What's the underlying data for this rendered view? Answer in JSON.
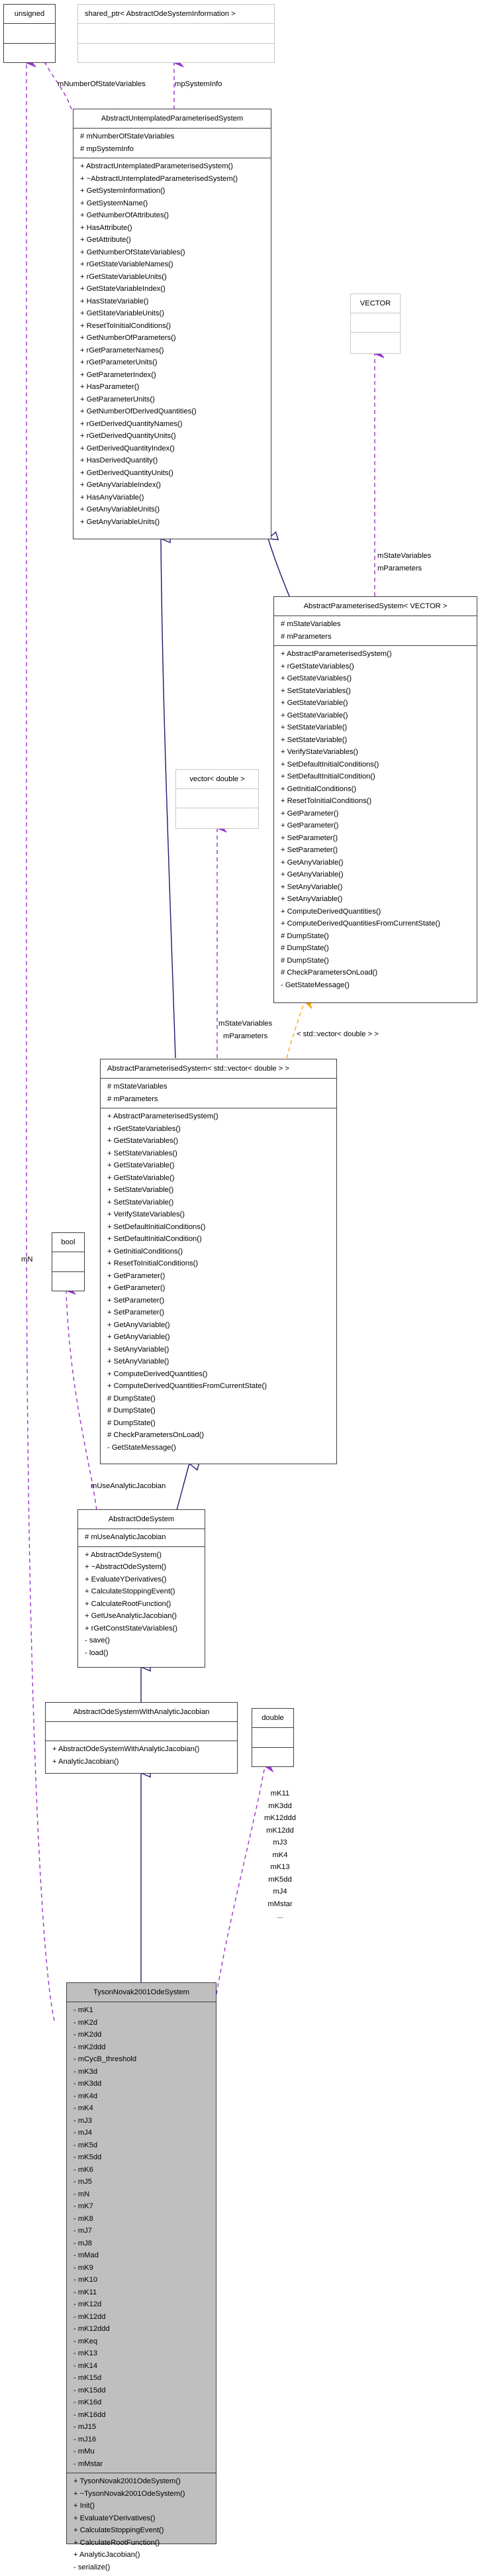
{
  "colors": {
    "inheritance": "#191970",
    "usage": "#9a32cd",
    "template": "#ffa500",
    "focus_fill": "#bfbfbf",
    "border": "#404040",
    "external_border": "#c8c8c8"
  },
  "classes": {
    "unsigned": {
      "title": "unsigned",
      "attributes": [],
      "methods": []
    },
    "shared_ptr": {
      "title": "shared_ptr< AbstractOdeSystemInformation >",
      "attributes": [],
      "methods": []
    },
    "aups": {
      "title": "AbstractUntemplatedParameterisedSystem",
      "attributes": [
        "# mNumberOfStateVariables",
        "# mpSystemInfo"
      ],
      "methods": [
        "+ AbstractUntemplatedParameterisedSystem()",
        "+ ~AbstractUntemplatedParameterisedSystem()",
        "+ GetSystemInformation()",
        "+ GetSystemName()",
        "+ GetNumberOfAttributes()",
        "+ HasAttribute()",
        "+ GetAttribute()",
        "+ GetNumberOfStateVariables()",
        "+ rGetStateVariableNames()",
        "+ rGetStateVariableUnits()",
        "+ GetStateVariableIndex()",
        "+ HasStateVariable()",
        "+ GetStateVariableUnits()",
        "+ ResetToInitialConditions()",
        "+ GetNumberOfParameters()",
        "+ rGetParameterNames()",
        "+ rGetParameterUnits()",
        "+ GetParameterIndex()",
        "+ HasParameter()",
        "+ GetParameterUnits()",
        "+ GetNumberOfDerivedQuantities()",
        "+ rGetDerivedQuantityNames()",
        "+ rGetDerivedQuantityUnits()",
        "+ GetDerivedQuantityIndex()",
        "+ HasDerivedQuantity()",
        "+ GetDerivedQuantityUnits()",
        "+ GetAnyVariableIndex()",
        "+ HasAnyVariable()",
        "+ GetAnyVariableUnits()",
        "+ GetAnyVariableUnits()"
      ]
    },
    "vector_t": {
      "title": "VECTOR",
      "attributes": [],
      "methods": []
    },
    "aps_vector": {
      "title": "AbstractParameterisedSystem< VECTOR >",
      "attributes": [
        "# mStateVariables",
        "# mParameters"
      ],
      "methods": [
        "+ AbstractParameterisedSystem()",
        "+ rGetStateVariables()",
        "+ GetStateVariables()",
        "+ SetStateVariables()",
        "+ GetStateVariable()",
        "+ GetStateVariable()",
        "+ SetStateVariable()",
        "+ SetStateVariable()",
        "+ VerifyStateVariables()",
        "+ SetDefaultInitialConditions()",
        "+ SetDefaultInitialCondition()",
        "+ GetInitialConditions()",
        "+ ResetToInitialConditions()",
        "+ GetParameter()",
        "+ GetParameter()",
        "+ SetParameter()",
        "+ SetParameter()",
        "+ GetAnyVariable()",
        "+ GetAnyVariable()",
        "+ SetAnyVariable()",
        "+ SetAnyVariable()",
        "+ ComputeDerivedQuantities()",
        "+ ComputeDerivedQuantitiesFromCurrentState()",
        "# DumpState()",
        "# DumpState()",
        "# DumpState()",
        "# CheckParametersOnLoad()",
        "- GetStateMessage()"
      ]
    },
    "vector_double": {
      "title": "vector< double >",
      "attributes": [],
      "methods": []
    },
    "aps_std": {
      "title": "AbstractParameterisedSystem< std::vector< double > >",
      "attributes": [
        "# mStateVariables",
        "# mParameters"
      ],
      "methods": [
        "+ AbstractParameterisedSystem()",
        "+ rGetStateVariables()",
        "+ GetStateVariables()",
        "+ SetStateVariables()",
        "+ GetStateVariable()",
        "+ GetStateVariable()",
        "+ SetStateVariable()",
        "+ SetStateVariable()",
        "+ VerifyStateVariables()",
        "+ SetDefaultInitialConditions()",
        "+ SetDefaultInitialCondition()",
        "+ GetInitialConditions()",
        "+ ResetToInitialConditions()",
        "+ GetParameter()",
        "+ GetParameter()",
        "+ SetParameter()",
        "+ SetParameter()",
        "+ GetAnyVariable()",
        "+ GetAnyVariable()",
        "+ SetAnyVariable()",
        "+ SetAnyVariable()",
        "+ ComputeDerivedQuantities()",
        "+ ComputeDerivedQuantitiesFromCurrentState()",
        "# DumpState()",
        "# DumpState()",
        "# DumpState()",
        "# CheckParametersOnLoad()",
        "- GetStateMessage()"
      ]
    },
    "bool": {
      "title": "bool",
      "attributes": [],
      "methods": []
    },
    "aos": {
      "title": "AbstractOdeSystem",
      "attributes": [
        "# mUseAnalyticJacobian"
      ],
      "methods": [
        "+ AbstractOdeSystem()",
        "+ ~AbstractOdeSystem()",
        "+ EvaluateYDerivatives()",
        "+ CalculateStoppingEvent()",
        "+ CalculateRootFunction()",
        "+ GetUseAnalyticJacobian()",
        "+ rGetConstStateVariables()",
        "- save()",
        "- load()"
      ]
    },
    "aoswaj": {
      "title": "AbstractOdeSystemWithAnalyticJacobian",
      "attributes": [],
      "methods": [
        "+ AbstractOdeSystemWithAnalyticJacobian()",
        "+ AnalyticJacobian()"
      ]
    },
    "double": {
      "title": "double",
      "attributes": [],
      "methods": []
    },
    "tyson": {
      "title": "TysonNovak2001OdeSystem",
      "attributes": [
        "- mK1",
        "- mK2d",
        "- mK2dd",
        "- mK2ddd",
        "- mCycB_threshold",
        "- mK3d",
        "- mK3dd",
        "- mK4d",
        "- mK4",
        "- mJ3",
        "- mJ4",
        "- mK5d",
        "- mK5dd",
        "- mK6",
        "- mJ5",
        "- mN",
        "- mK7",
        "- mK8",
        "- mJ7",
        "- mJ8",
        "- mMad",
        "- mK9",
        "- mK10",
        "- mK11",
        "- mK12d",
        "- mK12dd",
        "- mK12ddd",
        "- mKeq",
        "- mK13",
        "- mK14",
        "- mK15d",
        "- mK15dd",
        "- mK16d",
        "- mK16dd",
        "- mJ15",
        "- mJ16",
        "- mMu",
        "- mMstar"
      ],
      "methods": [
        "+ TysonNovak2001OdeSystem()",
        "+ ~TysonNovak2001OdeSystem()",
        "+ Init()",
        "+ EvaluateYDerivatives()",
        "+ CalculateStoppingEvent()",
        "+ CalculateRootFunction()",
        "+ AnalyticJacobian()",
        "- serialize()"
      ]
    }
  },
  "edge_labels": {
    "mNumberOfStateVariables": [
      "mNumberOfStateVariables"
    ],
    "mpSystemInfo": [
      "mpSystemInfo"
    ],
    "vector_members": [
      "mStateVariables",
      "mParameters"
    ],
    "vecdouble_members": [
      "mStateVariables",
      "mParameters"
    ],
    "template_arg": [
      "< std::vector< double > >"
    ],
    "mN": [
      "mN"
    ],
    "mUseAnalyticJacobian": [
      "mUseAnalyticJacobian"
    ],
    "double_members": [
      "mK11",
      "mK3dd",
      "mK12ddd",
      "mK12dd",
      "mJ3",
      "mK4",
      "mK13",
      "mK5dd",
      "mJ4",
      "mMstar",
      "..."
    ]
  }
}
